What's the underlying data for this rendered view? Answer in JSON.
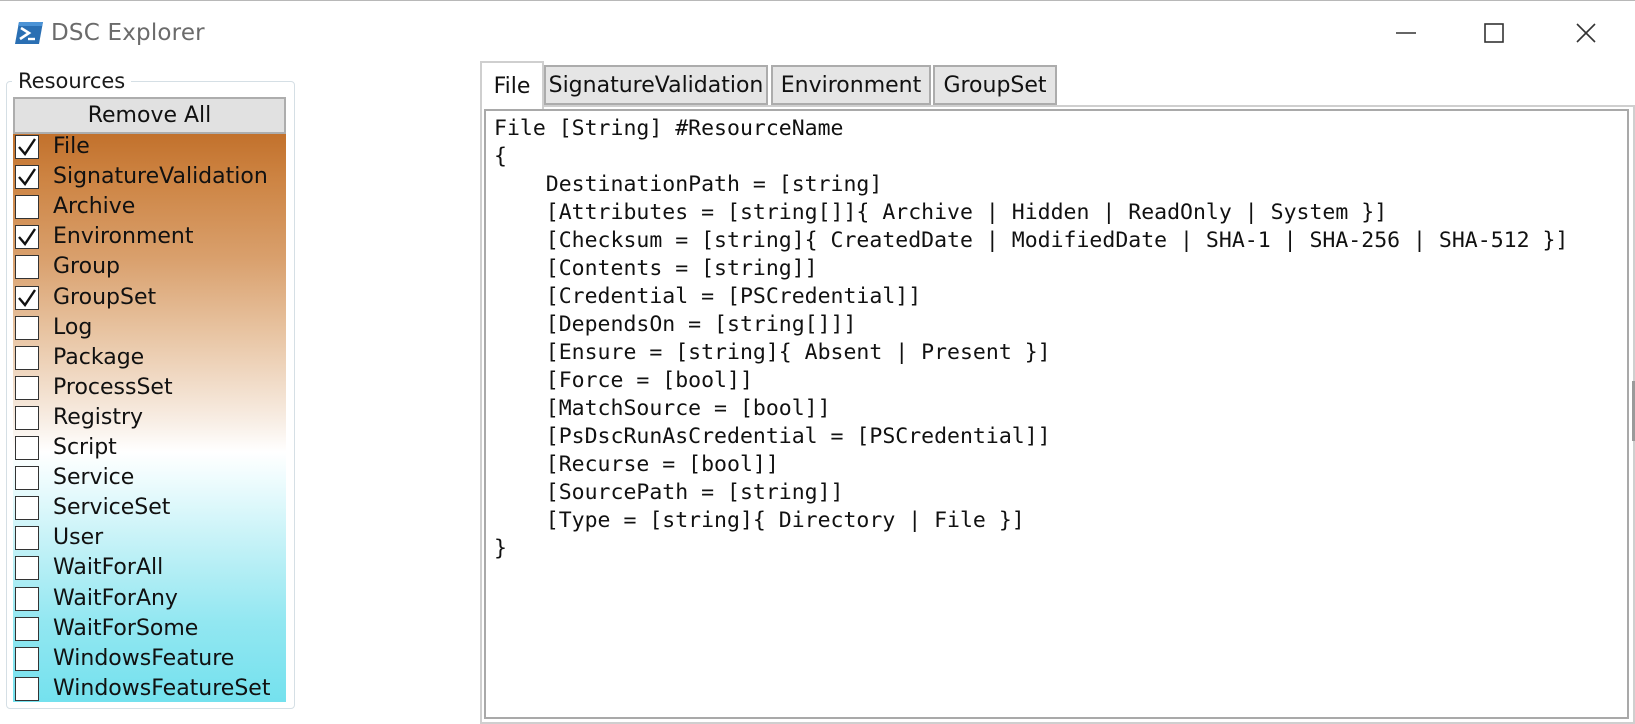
{
  "window": {
    "title": "DSC Explorer",
    "minimize_icon": "minimize-icon",
    "maximize_icon": "maximize-icon",
    "close_icon": "close-icon",
    "app_icon": "powershell-icon"
  },
  "resources": {
    "group_label": "Resources",
    "remove_all_label": "Remove All",
    "items": [
      {
        "label": "File",
        "checked": true
      },
      {
        "label": "SignatureValidation",
        "checked": true
      },
      {
        "label": "Archive",
        "checked": false
      },
      {
        "label": "Environment",
        "checked": true
      },
      {
        "label": "Group",
        "checked": false
      },
      {
        "label": "GroupSet",
        "checked": true
      },
      {
        "label": "Log",
        "checked": false
      },
      {
        "label": "Package",
        "checked": false
      },
      {
        "label": "ProcessSet",
        "checked": false
      },
      {
        "label": "Registry",
        "checked": false
      },
      {
        "label": "Script",
        "checked": false
      },
      {
        "label": "Service",
        "checked": false
      },
      {
        "label": "ServiceSet",
        "checked": false
      },
      {
        "label": "User",
        "checked": false
      },
      {
        "label": "WaitForAll",
        "checked": false
      },
      {
        "label": "WaitForAny",
        "checked": false
      },
      {
        "label": "WaitForSome",
        "checked": false
      },
      {
        "label": "WindowsFeature",
        "checked": false
      },
      {
        "label": "WindowsFeatureSet",
        "checked": false
      }
    ],
    "gradient_colors": [
      "#c2712c",
      "#ffffff",
      "#74e1ee"
    ]
  },
  "tabs": [
    {
      "label": "File",
      "active": true
    },
    {
      "label": "SignatureValidation",
      "active": false
    },
    {
      "label": "Environment",
      "active": false
    },
    {
      "label": "GroupSet",
      "active": false
    }
  ],
  "editor": {
    "lines": [
      "File [String] #ResourceName",
      "{",
      "    DestinationPath = [string]",
      "    [Attributes = [string[]]{ Archive | Hidden | ReadOnly | System }]",
      "    [Checksum = [string]{ CreatedDate | ModifiedDate | SHA-1 | SHA-256 | SHA-512 }]",
      "    [Contents = [string]]",
      "    [Credential = [PSCredential]]",
      "    [DependsOn = [string[]]]",
      "    [Ensure = [string]{ Absent | Present }]",
      "    [Force = [bool]]",
      "    [MatchSource = [bool]]",
      "    [PsDscRunAsCredential = [PSCredential]]",
      "    [Recurse = [bool]]",
      "    [SourcePath = [string]]",
      "    [Type = [string]{ Directory | File }]",
      "}"
    ]
  }
}
